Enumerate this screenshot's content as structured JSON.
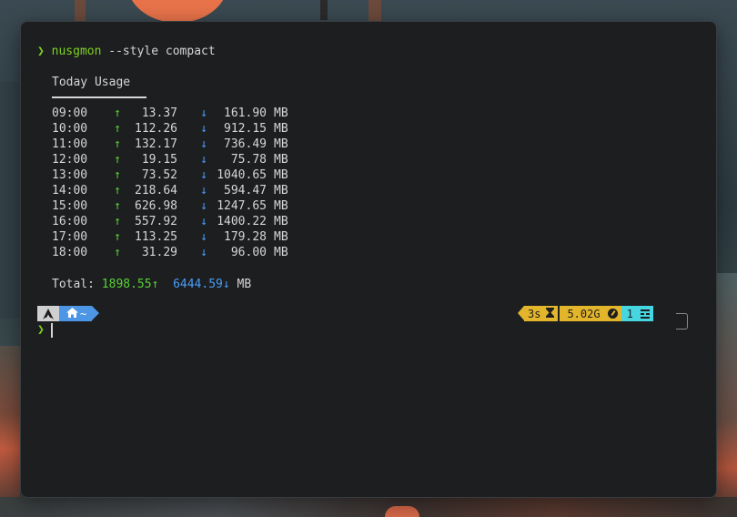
{
  "terminal": {
    "prompt_symbol": "❯",
    "command": "nusgmon",
    "arguments": " --style compact",
    "heading": "Today Usage",
    "up_arrow": "↑",
    "down_arrow": "↓",
    "unit": "MB",
    "rows": [
      {
        "time": "09:00",
        "up": "13.37",
        "down": "161.90"
      },
      {
        "time": "10:00",
        "up": "112.26",
        "down": "912.15"
      },
      {
        "time": "11:00",
        "up": "132.17",
        "down": "736.49"
      },
      {
        "time": "12:00",
        "up": "19.15",
        "down": "75.78"
      },
      {
        "time": "13:00",
        "up": "73.52",
        "down": "1040.65"
      },
      {
        "time": "14:00",
        "up": "218.64",
        "down": "594.47"
      },
      {
        "time": "15:00",
        "up": "626.98",
        "down": "1247.65"
      },
      {
        "time": "16:00",
        "up": "557.92",
        "down": "1400.22"
      },
      {
        "time": "17:00",
        "up": "113.25",
        "down": "179.28"
      },
      {
        "time": "18:00",
        "up": "31.29",
        "down": "96.00"
      }
    ],
    "total": {
      "label": "Total:",
      "up": "1898.55↑",
      "down": "6444.59↓",
      "unit": "MB"
    }
  },
  "powerline": {
    "os_icon": "arch-linux-icon",
    "path_icon": "home-icon",
    "path": "~",
    "duration": "3s",
    "duration_icon": "hourglass-icon",
    "memory": "5.02G",
    "memory_icon": "gauge-icon",
    "jobs": "1",
    "jobs_icon": "list-icon",
    "colors": {
      "os": "#d0d0d0",
      "path": "#4d96e6",
      "status": "#e3b52b",
      "jobs": "#46d6e0",
      "prompt": "#7ed321"
    }
  }
}
